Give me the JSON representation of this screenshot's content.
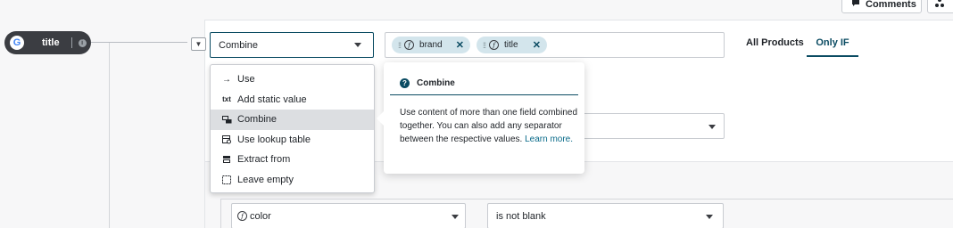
{
  "toolbar": {
    "comments_label": "Comments",
    "comments_icon": "comment-icon",
    "second_icon": "share-icon"
  },
  "field": {
    "icon": "google-icon",
    "name": "title",
    "info_icon": "info-icon"
  },
  "rule": {
    "mode_value": "Combine",
    "chips": [
      {
        "label": "brand"
      },
      {
        "label": "title"
      }
    ]
  },
  "tabs": {
    "all_products": "All Products",
    "only_if": "Only IF"
  },
  "menu": {
    "items": [
      {
        "label": "Use",
        "icon": "arrow-right-icon"
      },
      {
        "label": "Add static value",
        "icon": "txt"
      },
      {
        "label": "Combine",
        "icon": "combine-icon",
        "selected": true
      },
      {
        "label": "Use lookup table",
        "icon": "lookup-table-icon"
      },
      {
        "label": "Extract from",
        "icon": "extract-icon"
      },
      {
        "label": "Leave empty",
        "icon": "empty-box-icon"
      }
    ]
  },
  "tooltip": {
    "title": "Combine",
    "body": "Use content of more than one field combined together. You can also add any separator between the respective values.",
    "link": "Learn more."
  },
  "condition": {
    "field": "color",
    "operator": "is not blank"
  }
}
